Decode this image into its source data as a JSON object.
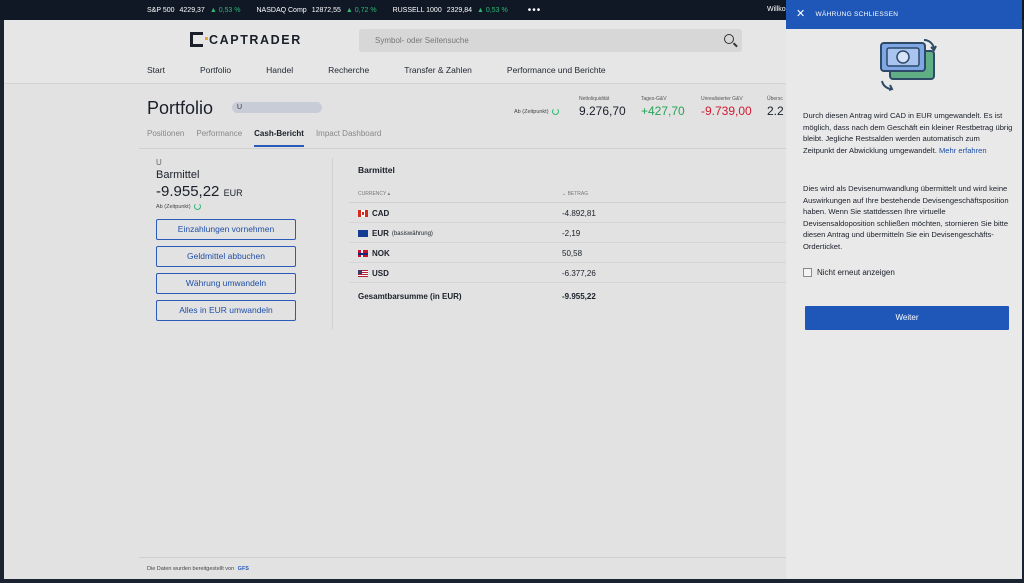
{
  "ticker": {
    "items": [
      {
        "name": "S&P 500",
        "value": "4229,37",
        "change": "▲ 0,53 %"
      },
      {
        "name": "NASDAQ Comp",
        "value": "12872,55",
        "change": "▲ 0,72 %"
      },
      {
        "name": "RUSSELL 1000",
        "value": "2329,84",
        "change": "▲ 0,53 %"
      }
    ],
    "more": "•••",
    "welcome": "Willko"
  },
  "header": {
    "logo_text": "CAPTRADER",
    "search_placeholder": "Symbol- oder Seitensuche",
    "nav": [
      "Start",
      "Portfolio",
      "Handel",
      "Recherche",
      "Transfer & Zahlen",
      "Performance und Berichte"
    ]
  },
  "portfolio": {
    "title": "Portfolio",
    "account_pill": "U",
    "as_of": "Ab (Zeitpunkt)",
    "metrics": [
      {
        "label": "Nettoliquidität",
        "value": "9.276,70",
        "tone": "neutral"
      },
      {
        "label": "Tages-G&V",
        "value": "+427,70",
        "tone": "positive"
      },
      {
        "label": "Unrealisierter G&V",
        "value": "-9.739,00",
        "tone": "negative"
      },
      {
        "label": "Übersc",
        "value": "2.2",
        "tone": "neutral"
      }
    ],
    "tabs": [
      "Positionen",
      "Performance",
      "Cash-Bericht",
      "Impact Dashboard"
    ],
    "active_tab": "Cash-Bericht"
  },
  "cash_summary": {
    "account": "U",
    "title": "Barmittel",
    "amount": "-9.955,22",
    "currency": "EUR",
    "as_of": "Ab (Zeitpunkt)",
    "buttons": [
      "Einzahlungen vornehmen",
      "Geldmittel abbuchen",
      "Währung umwandeln",
      "Alles in EUR umwandeln"
    ]
  },
  "cash_table": {
    "title": "Barmittel",
    "col_currency": "CURRENCY ▴",
    "col_amount": "⌄ BETRAG",
    "rows": [
      {
        "flag": "cad",
        "currency": "CAD",
        "sub": "",
        "amount": "-4.892,81"
      },
      {
        "flag": "eur",
        "currency": "EUR",
        "sub": "(basiswährung)",
        "amount": "-2,19"
      },
      {
        "flag": "nok",
        "currency": "NOK",
        "sub": "",
        "amount": "50,58"
      },
      {
        "flag": "usd",
        "currency": "USD",
        "sub": "",
        "amount": "-6.377,26"
      }
    ],
    "total_label": "Gesamtbarsumme (in EUR)",
    "total_amount": "-9.955,22"
  },
  "footer": {
    "text": "Die Daten wurden bereitgestellt von",
    "provider": "GFS"
  },
  "drawer": {
    "header": "WÄHRUNG SCHLIESSEN",
    "close_glyph": "✕",
    "para1": "Durch diesen Antrag wird CAD in EUR umgewandelt. Es ist möglich, dass nach dem Geschäft ein kleiner Restbetrag übrig bleibt. Jegliche Restsalden werden automatisch zum Zeitpunkt der Abwicklung umgewandelt.",
    "link": "Mehr erfahren",
    "para2": "Dies wird als Devisenumwandlung übermittelt und wird keine Auswirkungen auf Ihre bestehende Devisengeschäftsposition haben. Wenn Sie stattdessen Ihre virtuelle Devisensaldoposition schließen möchten, stornieren Sie bitte diesen Antrag und übermitteln Sie ein Devisengeschäfts-Orderticket.",
    "checkbox_label": "Nicht erneut anzeigen",
    "checked": false,
    "primary_button": "Weiter",
    "accent": "#1f57b8"
  }
}
